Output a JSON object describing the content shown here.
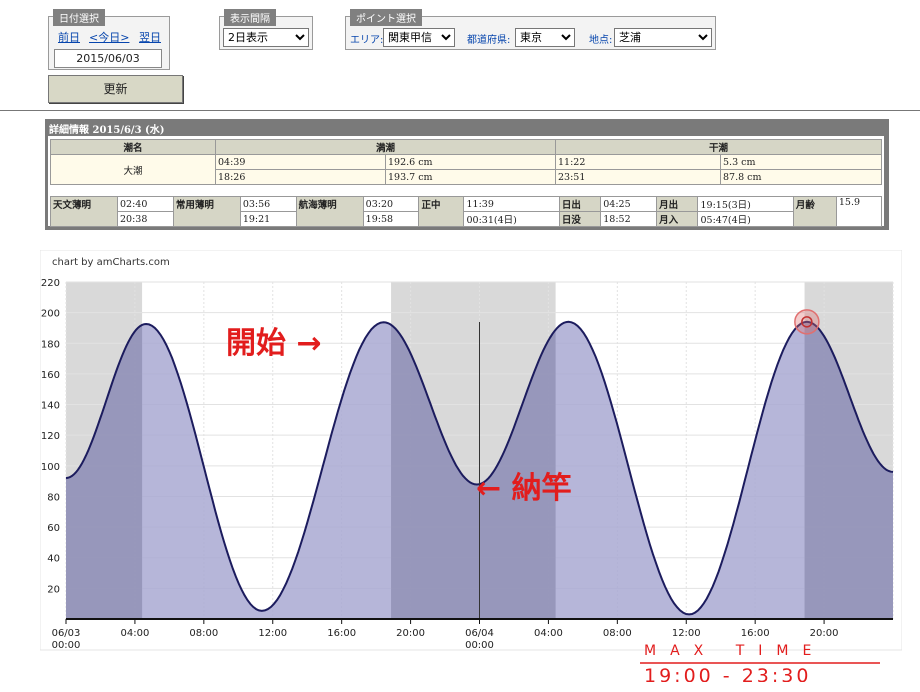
{
  "date_box": {
    "header": "日付選択",
    "prev": "前日",
    "today": "<今日>",
    "next": "翌日",
    "date": "2015/06/03"
  },
  "display_box": {
    "header": "表示間隔",
    "selected": "2日表示"
  },
  "point_box": {
    "header": "ポイント選択",
    "area_label": "エリア:",
    "area": "関東甲信",
    "pref_label": "都道府県:",
    "pref": "東京",
    "place_label": "地点:",
    "place": "芝浦"
  },
  "update_button": "更新",
  "detail": {
    "title": "詳細情報 2015/6/3 (水)",
    "tide_header": "潮名",
    "high_header": "満潮",
    "low_header": "干潮",
    "tide_name": "大潮",
    "high": [
      {
        "time": "04:39",
        "level": "192.6 cm"
      },
      {
        "time": "18:26",
        "level": "193.7 cm"
      }
    ],
    "low": [
      {
        "time": "11:22",
        "level": "5.3 cm"
      },
      {
        "time": "23:51",
        "level": "87.8 cm"
      }
    ],
    "astro": {
      "tenmon_label": "天文薄明",
      "tenmon": [
        "02:40",
        "20:38"
      ],
      "joyo_label": "常用薄明",
      "joyo": [
        "03:56",
        "19:21"
      ],
      "kokai_label": "航海薄明",
      "kokai": [
        "03:20",
        "19:58"
      ],
      "shochu_label": "正中",
      "shochu": [
        "11:39",
        "00:31(4日)"
      ],
      "sunrise_label": "日出",
      "sunrise": "04:25",
      "sunset_label": "日没",
      "sunset": "18:52",
      "moonrise_label": "月出",
      "moonrise": "19:15(3日)",
      "moonset_label": "月入",
      "moonset": "05:47(4日)",
      "moonage_label": "月齢",
      "moonage": "15.9"
    }
  },
  "chart_data": {
    "type": "area",
    "credit": "chart by amCharts.com",
    "ylim": [
      0,
      220
    ],
    "yticks": [
      20,
      40,
      60,
      80,
      100,
      120,
      140,
      160,
      180,
      200,
      220
    ],
    "x_hours_range": [
      0,
      48
    ],
    "xtick_labels": [
      [
        "06/03",
        "00:00"
      ],
      [
        "04:00"
      ],
      [
        "08:00"
      ],
      [
        "12:00"
      ],
      [
        "16:00"
      ],
      [
        "20:00"
      ],
      [
        "06/04",
        "00:00"
      ],
      [
        "04:00"
      ],
      [
        "08:00"
      ],
      [
        "12:00"
      ],
      [
        "16:00"
      ],
      [
        "20:00"
      ]
    ],
    "series": [
      {
        "extrema": [
          {
            "t": "06/03 00:00",
            "v": 92
          },
          {
            "t": "06/03 04:39",
            "v": 192.6
          },
          {
            "t": "06/03 11:22",
            "v": 5.3
          },
          {
            "t": "06/03 18:26",
            "v": 193.7
          },
          {
            "t": "06/03 23:51",
            "v": 87.8
          },
          {
            "t": "06/04 05:10",
            "v": 194
          },
          {
            "t": "06/04 12:10",
            "v": 3
          },
          {
            "t": "06/04 19:00",
            "v": 194
          },
          {
            "t": "06/04 24:00",
            "v": 96
          }
        ]
      }
    ],
    "night_bands": [
      [
        "06/03 00:00",
        "06/03 04:25"
      ],
      [
        "06/03 18:52",
        "06/04 04:25"
      ],
      [
        "06/04 18:52",
        "06/04 24:00"
      ]
    ],
    "cursor": "06/04 00:00",
    "colors": {
      "line": "#1c1c5e",
      "fill": "#a9a9d2",
      "night": "#d9d9d9",
      "cursor_circle": "#e07070"
    },
    "annotations": {
      "start": "開始 →",
      "nattoku": "← 納竿",
      "max_time_title": "MAX TIME",
      "max_time_value": "19:00 - 23:30"
    }
  }
}
